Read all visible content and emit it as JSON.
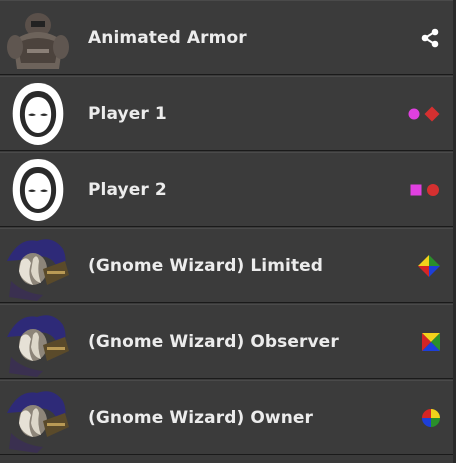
{
  "tokens": [
    {
      "name": "Animated Armor",
      "avatar": "animated-armor",
      "action": "share-icon"
    },
    {
      "name": "Player 1",
      "avatar": "hooded-player",
      "markers": [
        {
          "shape": "circle",
          "color": "#e040e0"
        },
        {
          "shape": "diamond",
          "color": "#d53030"
        }
      ]
    },
    {
      "name": "Player 2",
      "avatar": "hooded-player",
      "markers": [
        {
          "shape": "square",
          "color": "#e040e0"
        },
        {
          "shape": "circle",
          "color": "#d53030"
        }
      ]
    },
    {
      "name": "(Gnome Wizard) Limited",
      "avatar": "gnome-wizard",
      "badge": "multicolor-diamond"
    },
    {
      "name": "(Gnome Wizard) Observer",
      "avatar": "gnome-wizard",
      "badge": "multicolor-square"
    },
    {
      "name": "(Gnome Wizard) Owner",
      "avatar": "gnome-wizard",
      "badge": "multicolor-circle"
    }
  ],
  "colors": {
    "background": "#3b3b3b",
    "text": "#ececec",
    "badge": [
      "#f2d21b",
      "#2a8f2a",
      "#1d3fd8",
      "#d52525"
    ]
  }
}
